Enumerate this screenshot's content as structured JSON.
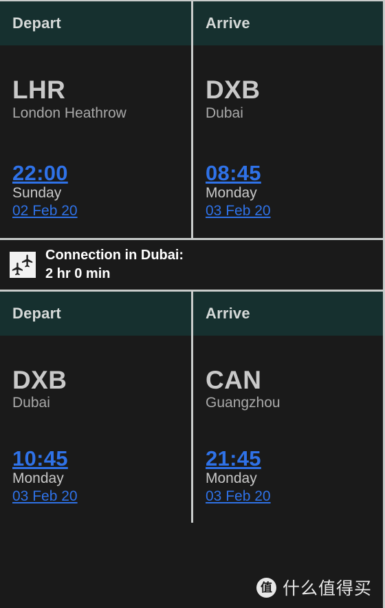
{
  "colors": {
    "header_bg": "#16302f",
    "body_bg": "#1a1a1a",
    "divider": "#c9cccb",
    "link_blue": "#2f72e8",
    "code_gray": "#c9c9c9",
    "city_gray": "#a9a9a9"
  },
  "segments": [
    {
      "depart": {
        "column_label": "Depart",
        "code": "LHR",
        "city": "London Heathrow",
        "time": "22:00",
        "weekday": "Sunday",
        "date": "02 Feb 20"
      },
      "arrive": {
        "column_label": "Arrive",
        "code": "DXB",
        "city": "Dubai",
        "time": "08:45",
        "weekday": "Monday",
        "date": "03 Feb 20"
      }
    },
    {
      "depart": {
        "column_label": "Depart",
        "code": "DXB",
        "city": "Dubai",
        "time": "10:45",
        "weekday": "Monday",
        "date": "03 Feb 20"
      },
      "arrive": {
        "column_label": "Arrive",
        "code": "CAN",
        "city": "Guangzhou",
        "time": "21:45",
        "weekday": "Monday",
        "date": "03 Feb 20"
      }
    }
  ],
  "connection": {
    "icon": "connecting-flights-icon",
    "title": "Connection in Dubai:",
    "duration": "2 hr 0 min"
  },
  "watermark": {
    "logo_char": "值",
    "text": "什么值得买"
  }
}
